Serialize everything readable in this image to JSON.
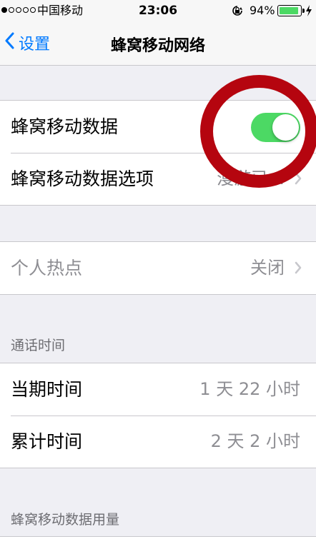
{
  "status_bar": {
    "carrier": "中国移动",
    "time": "23:06",
    "battery_percent": "94%",
    "battery_level": 0.94,
    "signal_bars_filled": 1,
    "signal_bars_total": 5
  },
  "nav": {
    "back_label": "设置",
    "title": "蜂窝移动网络"
  },
  "cellular_group": {
    "cellular_data_label": "蜂窝移动数据",
    "cellular_data_on": true,
    "options_label": "蜂窝移动数据选项",
    "options_value": "漫游已..."
  },
  "hotspot": {
    "label": "个人热点",
    "value": "关闭"
  },
  "call_time": {
    "header": "通话时间",
    "current_label": "当期时间",
    "current_value": "1 天 22 小时",
    "lifetime_label": "累计时间",
    "lifetime_value": "2 天 2 小时"
  },
  "usage": {
    "header": "蜂窝移动数据用量"
  },
  "colors": {
    "accent": "#007aff",
    "switch_on": "#4cd964",
    "battery": "#4cd964",
    "annotation": "#b5050f"
  }
}
